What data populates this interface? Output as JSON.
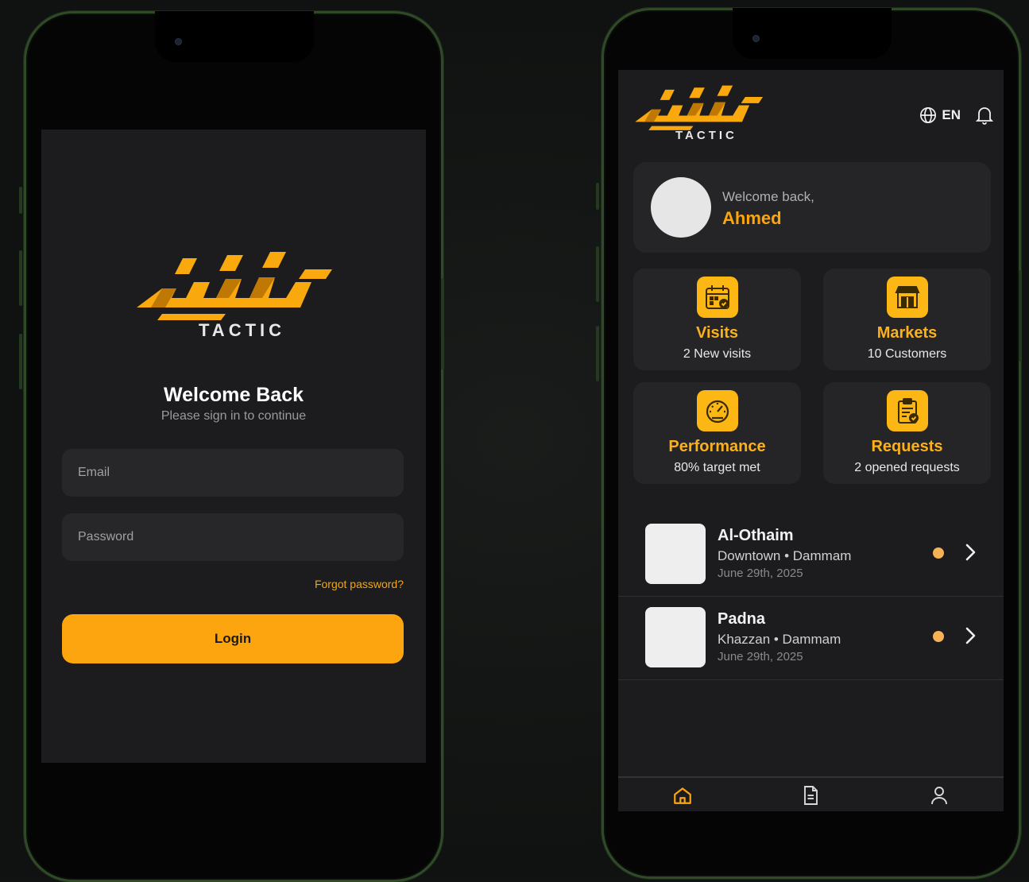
{
  "brand": {
    "name": "TACTIC",
    "accent": "#fca50f",
    "logo_icon": "tactic-arabic-calligraphy-logo"
  },
  "login": {
    "title": "Welcome Back",
    "subtitle": "Please sign in to continue",
    "email": {
      "value": "",
      "placeholder": "Email"
    },
    "password": {
      "value": "",
      "placeholder": "Password"
    },
    "forgot_label": "Forgot password?",
    "login_label": "Login"
  },
  "dashboard": {
    "header": {
      "language_label": "EN",
      "language_icon": "globe-icon",
      "notifications_icon": "bell-icon"
    },
    "welcome": {
      "greeting": "Welcome back,",
      "user_name": "Ahmed"
    },
    "tiles": [
      {
        "title": "Visits",
        "subtitle": "2 New visits",
        "icon": "calendar-check-icon"
      },
      {
        "title": "Markets",
        "subtitle": "10 Customers",
        "icon": "storefront-icon"
      },
      {
        "title": "Performance",
        "subtitle": "80% target met",
        "icon": "speedometer-icon"
      },
      {
        "title": "Requests",
        "subtitle": "2 opened requests",
        "icon": "clipboard-check-icon"
      }
    ],
    "visits": [
      {
        "name": "Al-Othaim",
        "location": "Downtown • Dammam",
        "date": "June 29th, 2025",
        "status_color": "#f6b255"
      },
      {
        "name": "Padna",
        "location": "Khazzan • Dammam",
        "date": "June 29th, 2025",
        "status_color": "#f6b255"
      }
    ],
    "tabbar": [
      {
        "icon": "home-icon",
        "active": true
      },
      {
        "icon": "document-icon",
        "active": false
      },
      {
        "icon": "user-icon",
        "active": false
      }
    ]
  }
}
